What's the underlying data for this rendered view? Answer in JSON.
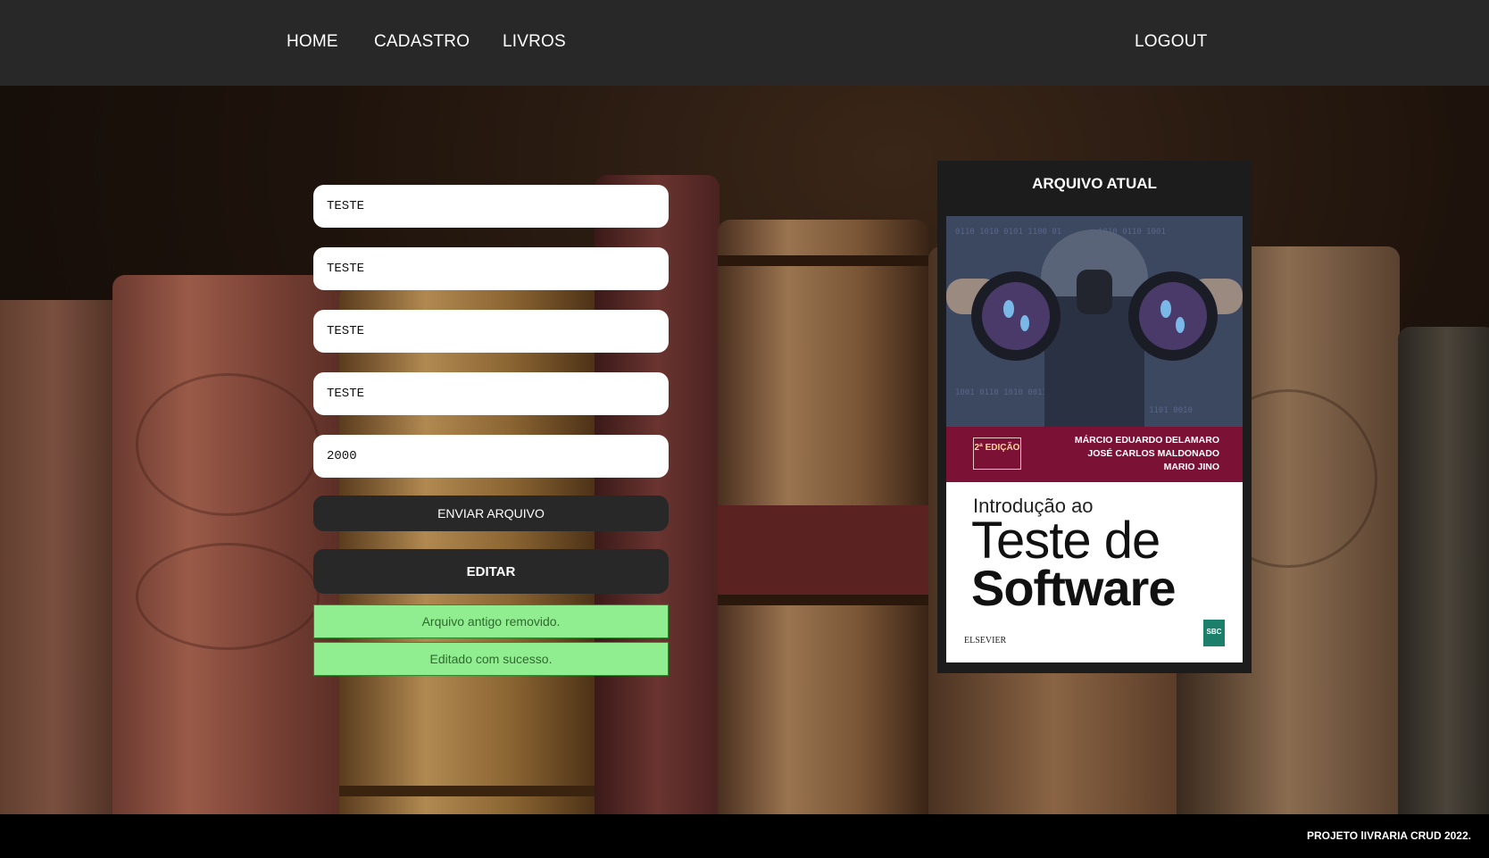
{
  "nav": {
    "home": "HOME",
    "cadastro": "CADASTRO",
    "livros": "LIVROS",
    "logout": "LOGOUT"
  },
  "form": {
    "fields": [
      {
        "value": "TESTE"
      },
      {
        "value": "TESTE"
      },
      {
        "value": "TESTE"
      },
      {
        "value": "TESTE"
      },
      {
        "value": "2000"
      }
    ],
    "upload_label": "ENVIAR ARQUIVO",
    "edit_label": "EDITAR",
    "messages": [
      "Arquivo antigo removido.",
      "Editado com sucesso."
    ]
  },
  "current_file": {
    "title": "ARQUIVO ATUAL",
    "cover": {
      "edition": "2ª EDIÇÃO",
      "authors": [
        "MÁRCIO EDUARDO DELAMARO",
        "JOSÉ CARLOS MALDONADO",
        "MARIO JINO"
      ],
      "title_line1": "Introdução ao",
      "title_line2": "Teste de",
      "title_line3": "Software",
      "publisher": "ELSEVIER",
      "series": "SBC"
    }
  },
  "footer": {
    "text": "PROJETO lIVRARIA CRUD 2022."
  },
  "colors": {
    "nav_bg": "#282828",
    "button_bg": "#282828",
    "success_bg": "#90ee90",
    "cover_band": "#7b1235"
  }
}
